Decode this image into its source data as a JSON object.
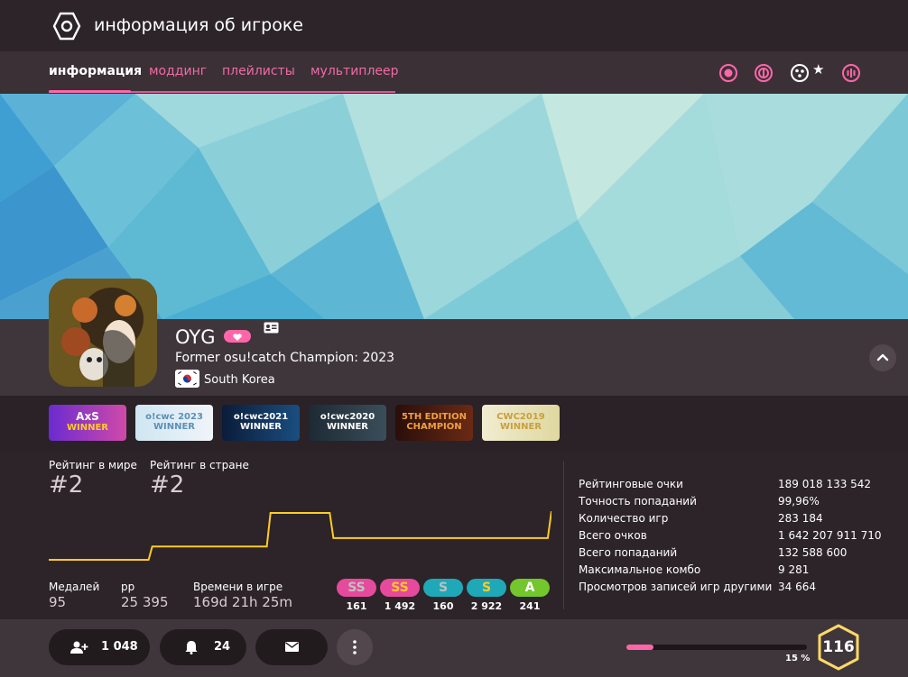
{
  "header": {
    "title": "информация об игроке"
  },
  "tabs": [
    {
      "label": "информация"
    },
    {
      "label": "моддинг"
    },
    {
      "label": "плейлисты"
    },
    {
      "label": "мультиплеер"
    }
  ],
  "modes": [
    {
      "icon": "osu-mode-icon"
    },
    {
      "icon": "taiko-mode-icon"
    },
    {
      "icon": "catch-mode-icon",
      "selected": true
    },
    {
      "icon": "mania-mode-icon"
    }
  ],
  "profile": {
    "username": "OYG",
    "title": "Former osu!catch Champion: 2023",
    "country": "South Korea"
  },
  "badges": [
    {
      "text": "AxS",
      "sub": "WINNER"
    },
    {
      "text": "o!cwc 2023",
      "sub": "WINNER"
    },
    {
      "text": "o!cwc2021",
      "sub": "WINNER"
    },
    {
      "text": "o!cwc2020",
      "sub": "WINNER"
    },
    {
      "text": "5TH EDITION",
      "sub": "CHAMPION"
    },
    {
      "text": "CWC2019",
      "sub": "WINNER"
    }
  ],
  "ranks": {
    "global_label": "Рейтинг в мире",
    "global_value": "#2",
    "country_label": "Рейтинг в стране",
    "country_value": "#2"
  },
  "rank_history": [
    0.08,
    0.08,
    0.08,
    0.08,
    0.08,
    0.08,
    0.08,
    0.08,
    0.08,
    0.08,
    0.08,
    0.08,
    0.08,
    0.08,
    0.08,
    0.08,
    0.08,
    0.08,
    0.08,
    0.08,
    0.08,
    0.08,
    0.08,
    0.08,
    0.08,
    0.08,
    0.08,
    0.08,
    0.32,
    0.32,
    0.32,
    0.32,
    0.32,
    0.32,
    0.32,
    0.32,
    0.32,
    0.32,
    0.32,
    0.32,
    0.32,
    0.32,
    0.32,
    0.32,
    0.32,
    0.32,
    0.32,
    0.32,
    0.32,
    0.32,
    0.32,
    0.32,
    0.32,
    0.32,
    0.32,
    0.32,
    0.32,
    0.32,
    0.32,
    0.32,
    0.92,
    0.92,
    0.92,
    0.92,
    0.92,
    0.92,
    0.92,
    0.92,
    0.92,
    0.92,
    0.92,
    0.92,
    0.92,
    0.92,
    0.92,
    0.92,
    0.92,
    0.47,
    0.47,
    0.47,
    0.47,
    0.47,
    0.47,
    0.47,
    0.47,
    0.47,
    0.47,
    0.47,
    0.47,
    0.47,
    0.47,
    0.47,
    0.47,
    0.47,
    0.47,
    0.47,
    0.47,
    0.47,
    0.47,
    0.47,
    0.47,
    0.47,
    0.47,
    0.47,
    0.47,
    0.47,
    0.47,
    0.47,
    0.47,
    0.47,
    0.47,
    0.47,
    0.47,
    0.47,
    0.47,
    0.47,
    0.47,
    0.47,
    0.47,
    0.47,
    0.47,
    0.47,
    0.47,
    0.47,
    0.47,
    0.47,
    0.47,
    0.47,
    0.47,
    0.47,
    0.47,
    0.47,
    0.47,
    0.47,
    0.47,
    0.47,
    0.95
  ],
  "misc": {
    "medals_label": "Медалей",
    "medals_value": "95",
    "pp_label": "pp",
    "pp_value": "25 395",
    "playtime_label": "Времени в игре",
    "playtime_value": "169d 21h 25m"
  },
  "grades": [
    {
      "label": "SS",
      "count": "161",
      "color": "#e64a9c",
      "text": "#c0c0c0"
    },
    {
      "label": "SS",
      "count": "1 492",
      "color": "#e64a9c",
      "text": "#ffcc22"
    },
    {
      "label": "S",
      "count": "160",
      "color": "#1fa8b8",
      "text": "#c0c0c0"
    },
    {
      "label": "S",
      "count": "2 922",
      "color": "#1fa8b8",
      "text": "#ffcc22"
    },
    {
      "label": "A",
      "count": "241",
      "color": "#73c62b",
      "text": "#ffffff"
    }
  ],
  "stats": [
    {
      "label": "Рейтинговые очки",
      "value": "189 018 133 542"
    },
    {
      "label": "Точность попаданий",
      "value": "99,96%"
    },
    {
      "label": "Количество игр",
      "value": "283 184"
    },
    {
      "label": "Всего очков",
      "value": "1 642 207 911 710"
    },
    {
      "label": "Всего попаданий",
      "value": "132 588 600"
    },
    {
      "label": "Максимальное комбо",
      "value": "9 281"
    },
    {
      "label": "Просмотров записей игр другими",
      "value": "34 664"
    }
  ],
  "social": {
    "followers": "1 048",
    "subscribers": "24"
  },
  "level": {
    "value": "116",
    "progress_label": "15 %",
    "progress_fraction": 0.15
  },
  "colors": {
    "accent": "#ff66aa",
    "rank_line": "#ffcc22",
    "level_ring": "#ffd966"
  }
}
